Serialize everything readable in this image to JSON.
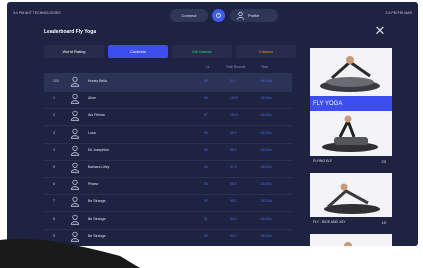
{
  "topbar": {
    "left_text": "3:4 PM  AHT  TECHNOLOGIES",
    "right_text": "3:4 PM  FRI MAR",
    "left_pill": "Connect",
    "right_pill": "Profile"
  },
  "panel": {
    "title": "Leaderboard Fly Yoga",
    "close_icon": "close-icon"
  },
  "tabs": [
    {
      "label": "World Rating"
    },
    {
      "label": "Contests"
    },
    {
      "label": "Kill Games"
    },
    {
      "label": "Classes"
    }
  ],
  "columns": [
    "1k",
    "Total Rounds",
    "Tims"
  ],
  "rows": [
    {
      "rank": "100",
      "name": "Honey Bella",
      "c1": "89",
      "c2": "5.0",
      "c3": "100.00s"
    },
    {
      "rank": "1",
      "name": "Aline",
      "c1": "99",
      "c2": "100.0",
      "c3": "100.00s"
    },
    {
      "rank": "2",
      "name": "Ark Perlow",
      "c1": "97",
      "c2": "100.0",
      "c3": "100.00s"
    },
    {
      "rank": "3",
      "name": "Luca",
      "c1": "96",
      "c2": "99.0",
      "c3": "100.00s"
    },
    {
      "rank": "4",
      "name": "Kit Josephine",
      "c1": "95",
      "c2": "98.0",
      "c3": "100.00s"
    },
    {
      "rank": "5",
      "name": "Barbara Lilley",
      "c1": "94",
      "c2": "97.0",
      "c3": "100.00s"
    },
    {
      "rank": "6",
      "name": "Pharia",
      "c1": "93",
      "c2": "96.0",
      "c3": "100.00s"
    },
    {
      "rank": "7",
      "name": "Be Strange",
      "c1": "92",
      "c2": "95.0",
      "c3": "100.00s"
    },
    {
      "rank": "8",
      "name": "Be Strange",
      "c1": "91",
      "c2": "94.0",
      "c3": "100.00s"
    },
    {
      "rank": "9",
      "name": "Be Strange",
      "c1": "90",
      "c2": "93.0",
      "c3": "100.00s"
    }
  ],
  "cards": [
    {
      "title": "FLY YOGA",
      "number": ""
    },
    {
      "title": "FLYING ELF",
      "number": "23"
    },
    {
      "title": "FLY - RIDE AND JOY",
      "number": "10"
    },
    {
      "title": "",
      "number": ""
    }
  ],
  "colors": {
    "background": "#1d2340",
    "accent": "#3c4ef0",
    "green": "#2fd38a",
    "orange": "#f08a2a",
    "value_blue": "#4f6ef5"
  }
}
